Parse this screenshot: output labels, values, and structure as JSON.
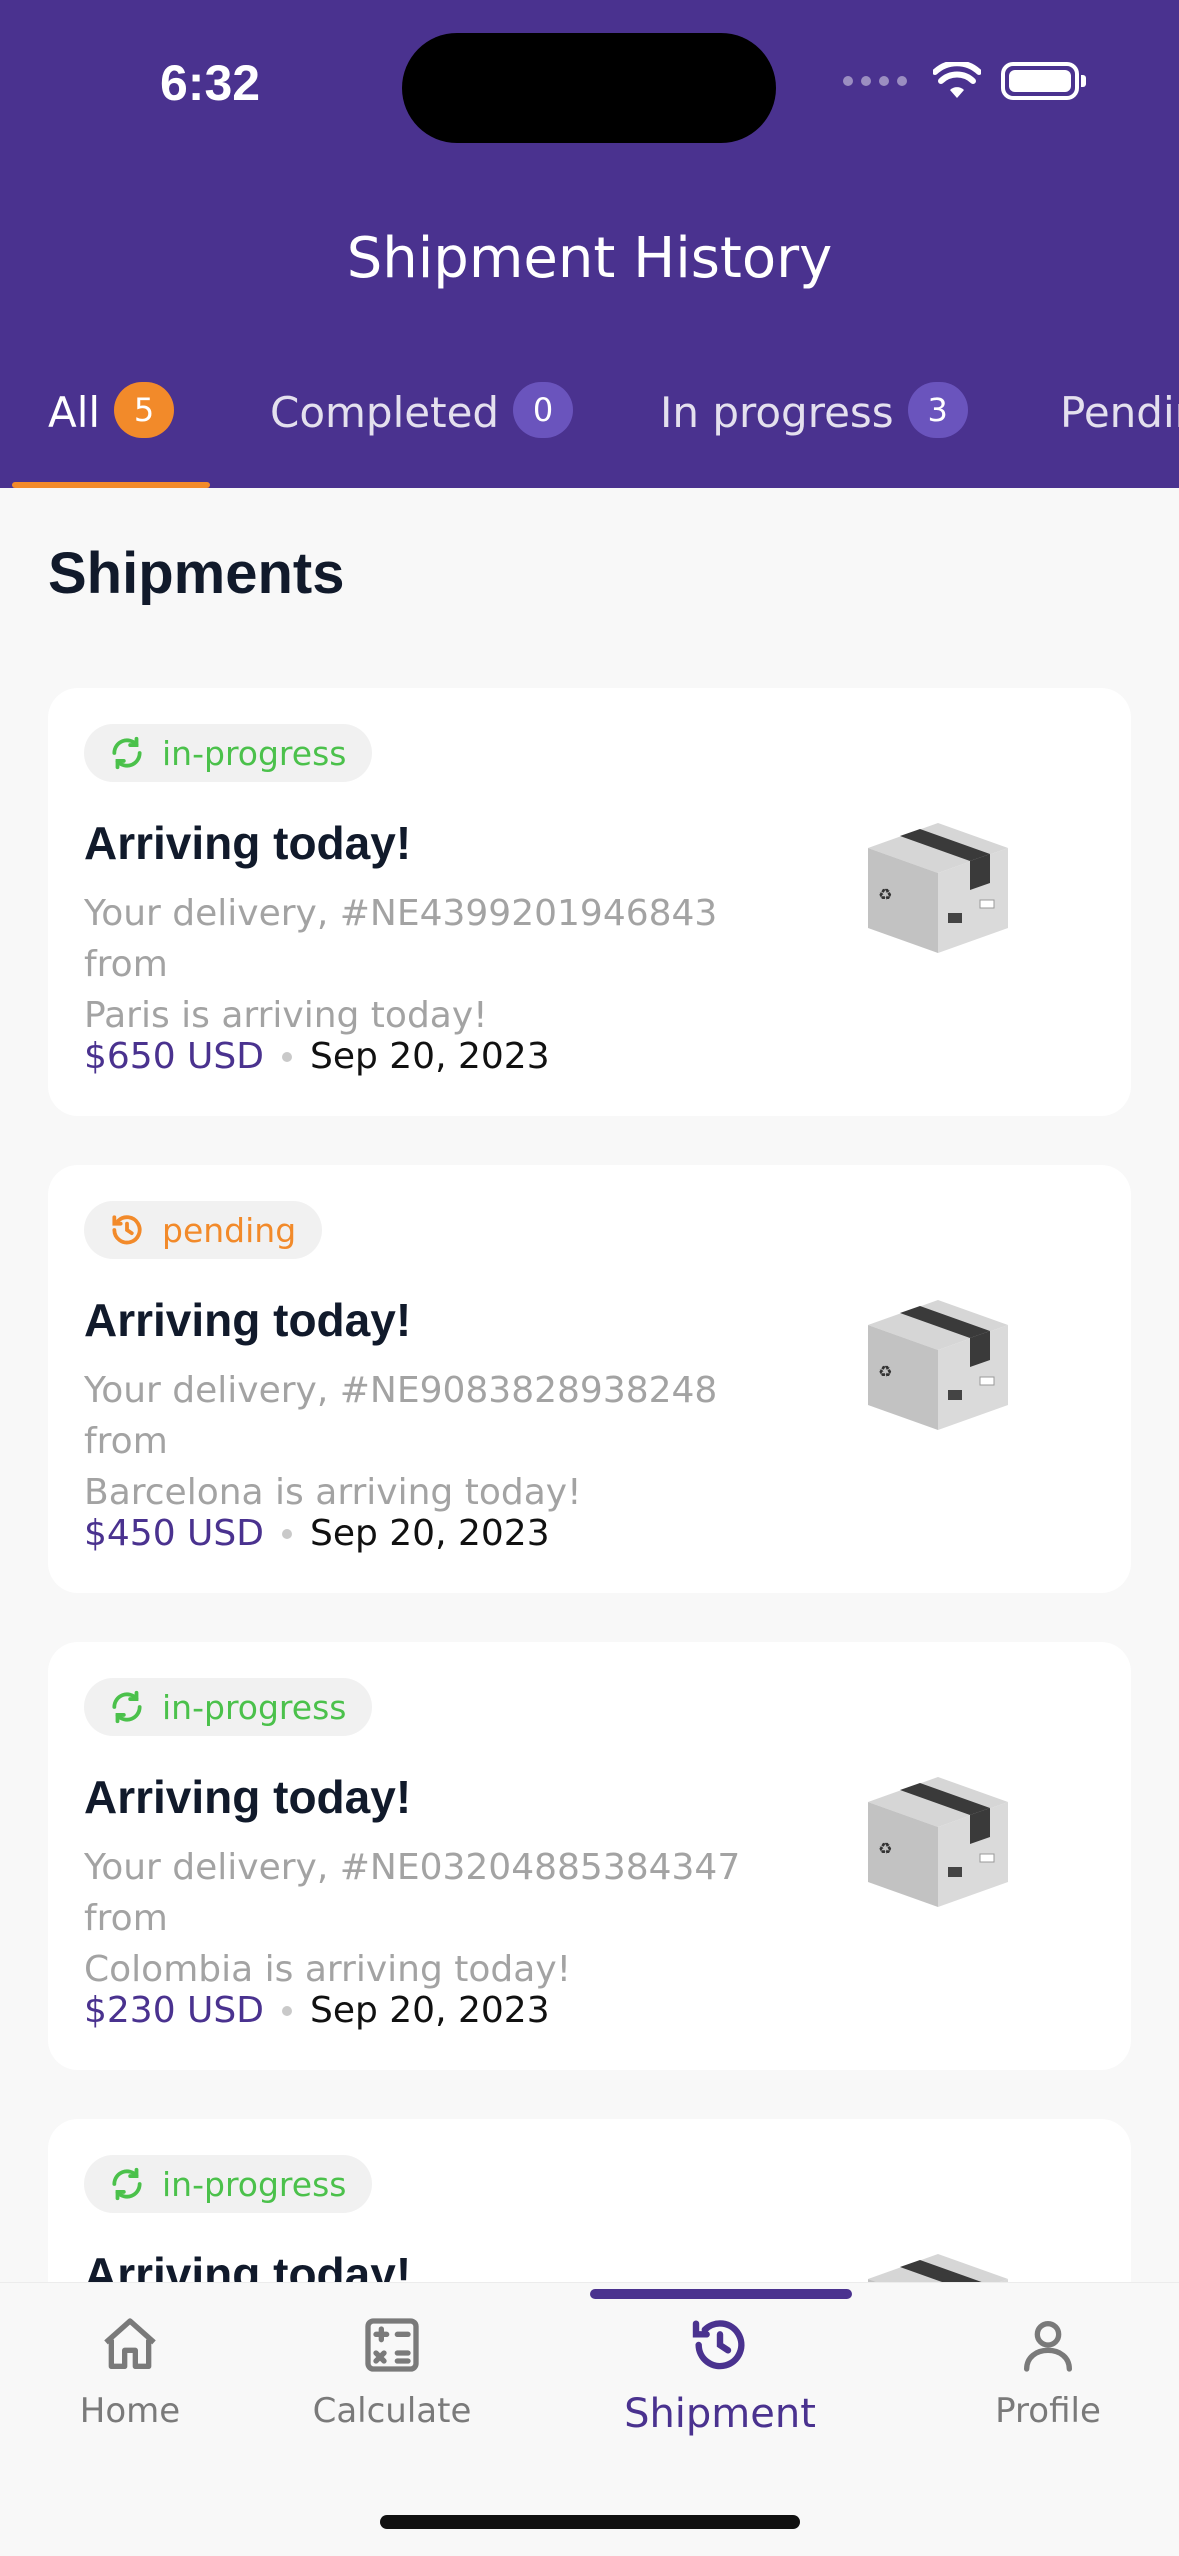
{
  "status_bar": {
    "time": "6:32"
  },
  "header": {
    "title": "Shipment History"
  },
  "tabs": [
    {
      "label": "All",
      "count": "5"
    },
    {
      "label": "Completed",
      "count": "0"
    },
    {
      "label": "In progress",
      "count": "3"
    },
    {
      "label": "Pending",
      "count": ""
    }
  ],
  "section": {
    "title": "Shipments"
  },
  "shipments": [
    {
      "status": "in-progress",
      "status_icon": "refresh-icon",
      "title": "Arriving today!",
      "desc_line1": "Your delivery, #NE4399201946843 from",
      "desc_line2": "Paris is arriving today!",
      "price": "$650 USD",
      "date": "Sep 20, 2023"
    },
    {
      "status": "pending",
      "status_icon": "history-icon",
      "title": "Arriving today!",
      "desc_line1": "Your delivery, #NE9083828938248 from",
      "desc_line2": "Barcelona is arriving today!",
      "price": "$450 USD",
      "date": "Sep 20, 2023"
    },
    {
      "status": "in-progress",
      "status_icon": "refresh-icon",
      "title": "Arriving today!",
      "desc_line1": "Your delivery, #NE03204885384347 from",
      "desc_line2": "Colombia is arriving today!",
      "price": "$230 USD",
      "date": "Sep 20, 2023"
    },
    {
      "status": "in-progress",
      "status_icon": "refresh-icon",
      "title": "Arriving today!",
      "desc_line1": "",
      "desc_line2": "",
      "price": "",
      "date": ""
    }
  ],
  "nav": [
    {
      "label": "Home",
      "icon": "home-icon"
    },
    {
      "label": "Calculate",
      "icon": "calculator-icon"
    },
    {
      "label": "Shipment",
      "icon": "history-icon"
    },
    {
      "label": "Profile",
      "icon": "profile-icon"
    }
  ],
  "colors": {
    "primary": "#4a328f",
    "accent": "#f28a2a",
    "success": "#4bc14b"
  }
}
